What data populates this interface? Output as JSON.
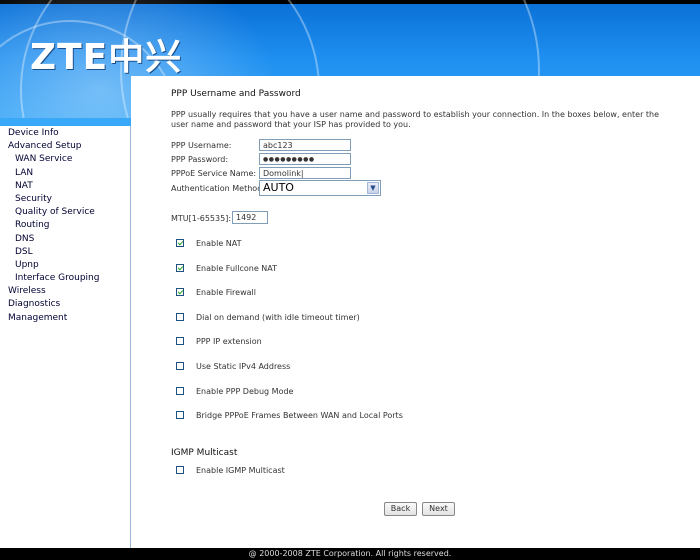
{
  "brand": {
    "logo": "ZTE中兴"
  },
  "sidebar": {
    "items": [
      {
        "label": "Device Info",
        "level": "top"
      },
      {
        "label": "Advanced Setup",
        "level": "top"
      },
      {
        "label": "WAN Service",
        "level": "sub"
      },
      {
        "label": "LAN",
        "level": "sub"
      },
      {
        "label": "NAT",
        "level": "sub"
      },
      {
        "label": "Security",
        "level": "sub"
      },
      {
        "label": "Quality of Service",
        "level": "sub"
      },
      {
        "label": "Routing",
        "level": "sub"
      },
      {
        "label": "DNS",
        "level": "sub"
      },
      {
        "label": "DSL",
        "level": "sub"
      },
      {
        "label": "Upnp",
        "level": "sub"
      },
      {
        "label": "Interface Grouping",
        "level": "sub"
      },
      {
        "label": "Wireless",
        "level": "top"
      },
      {
        "label": "Diagnostics",
        "level": "top"
      },
      {
        "label": "Management",
        "level": "top"
      }
    ]
  },
  "ppp": {
    "title": "PPP Username and Password",
    "description": "PPP usually requires that you have a user name and password to establish your connection. In the boxes below, enter the user name and password that your ISP has provided to you.",
    "username_label": "PPP Username:",
    "username_value": "abc123",
    "password_label": "PPP Password:",
    "password_value": "●●●●●●●●●",
    "service_label": "PPPoE Service Name:",
    "service_value": "Domolink|",
    "auth_label": "Authentication Method:",
    "auth_value": "AUTO",
    "mtu_label": "MTU[1-65535]:",
    "mtu_value": "1492"
  },
  "options": [
    {
      "label": "Enable NAT",
      "checked": true
    },
    {
      "label": "Enable Fullcone NAT",
      "checked": true
    },
    {
      "label": "Enable Firewall",
      "checked": true
    },
    {
      "label": "Dial on demand (with idle timeout timer)",
      "checked": false
    },
    {
      "label": "PPP IP extension",
      "checked": false
    },
    {
      "label": "Use Static IPv4 Address",
      "checked": false
    },
    {
      "label": "Enable PPP Debug Mode",
      "checked": false
    },
    {
      "label": "Bridge PPPoE Frames Between WAN and Local Ports",
      "checked": false
    }
  ],
  "igmp": {
    "title": "IGMP Multicast",
    "label": "Enable IGMP Multicast",
    "checked": false
  },
  "buttons": {
    "back": "Back",
    "next": "Next"
  },
  "footer": {
    "text": "@ 2000-2008 ZTE Corporation. All rights reserved."
  },
  "colors": {
    "header_blue": "#1e8ff0",
    "checkbox_check": "#21a121"
  }
}
